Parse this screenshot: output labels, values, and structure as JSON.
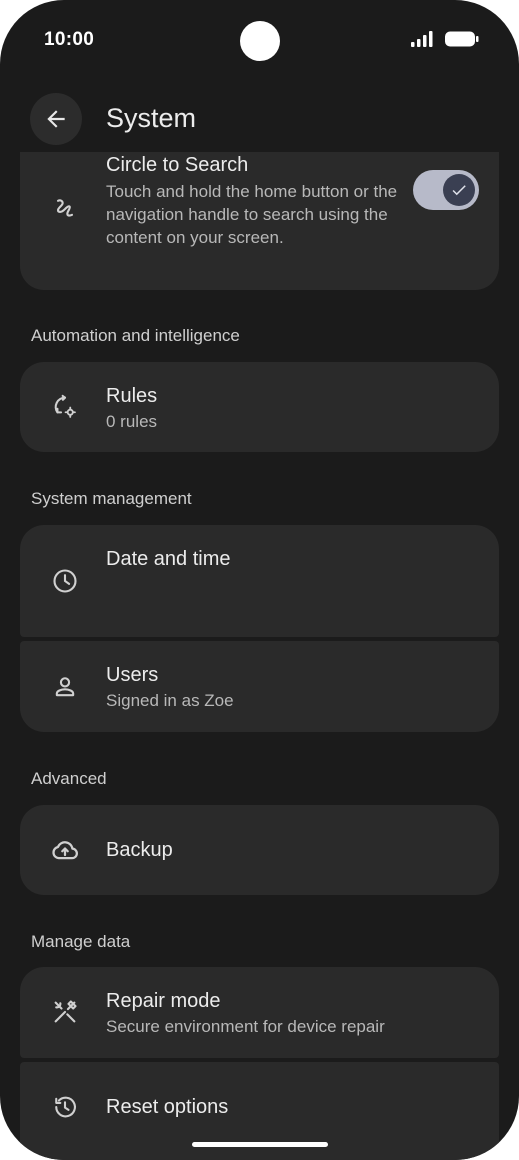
{
  "status_bar": {
    "time": "10:00"
  },
  "app_bar": {
    "title": "System",
    "back_icon": "arrow-back-icon"
  },
  "circle_to_search": {
    "title": "Circle to Search",
    "summary": "Touch and hold the home button or the navigation handle to search using the content on your screen.",
    "icon": "gesture-icon",
    "toggle_on": true
  },
  "sections": {
    "automation": "Automation and intelligence",
    "system_management": "System management",
    "advanced": "Advanced",
    "manage_data": "Manage data"
  },
  "rules": {
    "title": "Rules",
    "summary": "0 rules",
    "icon": "rules-sync-gear-icon"
  },
  "date_time": {
    "title": "Date and time",
    "icon": "clock-icon"
  },
  "users": {
    "title": "Users",
    "summary": "Signed in as Zoe",
    "icon": "person-icon"
  },
  "backup": {
    "title": "Backup",
    "icon": "cloud-upload-icon"
  },
  "repair_mode": {
    "title": "Repair mode",
    "summary": "Secure environment for device repair",
    "icon": "tools-icon"
  },
  "reset_options": {
    "title": "Reset options",
    "icon": "history-icon"
  },
  "colors": {
    "background": "#1b1b1b",
    "card": "#2a2a2a",
    "toggle_track": "#b7bac9",
    "toggle_thumb": "#3a3f52"
  }
}
